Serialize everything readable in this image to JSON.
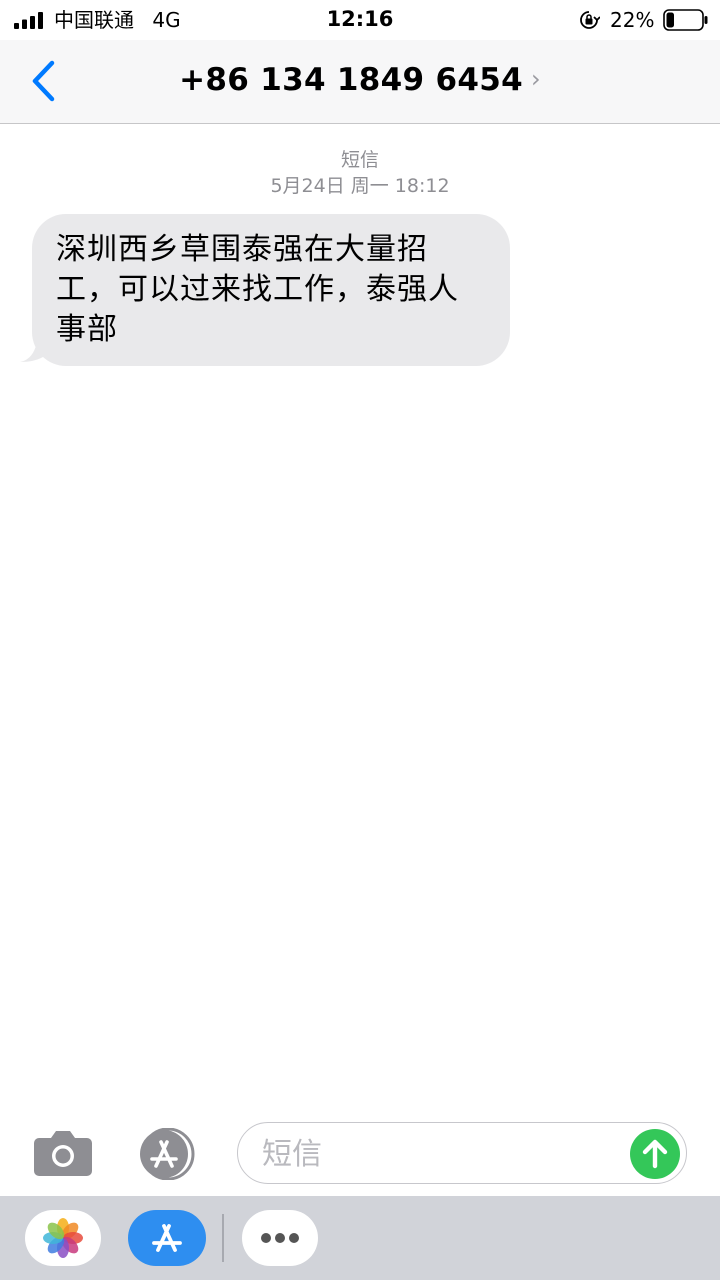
{
  "status_bar": {
    "carrier": "中国联通",
    "network": "4G",
    "time": "12:16",
    "battery_percent": "22%",
    "battery_level": 0.22
  },
  "nav": {
    "contact": "+86 134 1849 6454",
    "chevron": "›"
  },
  "conversation": {
    "service_label": "短信",
    "date_label": "5月24日 周一 18:12",
    "messages": [
      {
        "direction": "incoming",
        "text": "深圳西乡草围泰强在大量招工，可以过来找工作，泰强人事部"
      }
    ]
  },
  "compose": {
    "placeholder": "短信",
    "camera_icon": "camera-icon",
    "apps_icon": "app-store-icon",
    "send_icon": "send-arrow-icon"
  },
  "drawer": {
    "apps": [
      "photos-icon",
      "app-store-icon",
      "more-icon"
    ]
  },
  "colors": {
    "accent": "#007aff",
    "send": "#34c759",
    "bubble": "#e9e9eb",
    "meta_text": "#8e8e93",
    "store_blue": "#2e8ef0"
  }
}
